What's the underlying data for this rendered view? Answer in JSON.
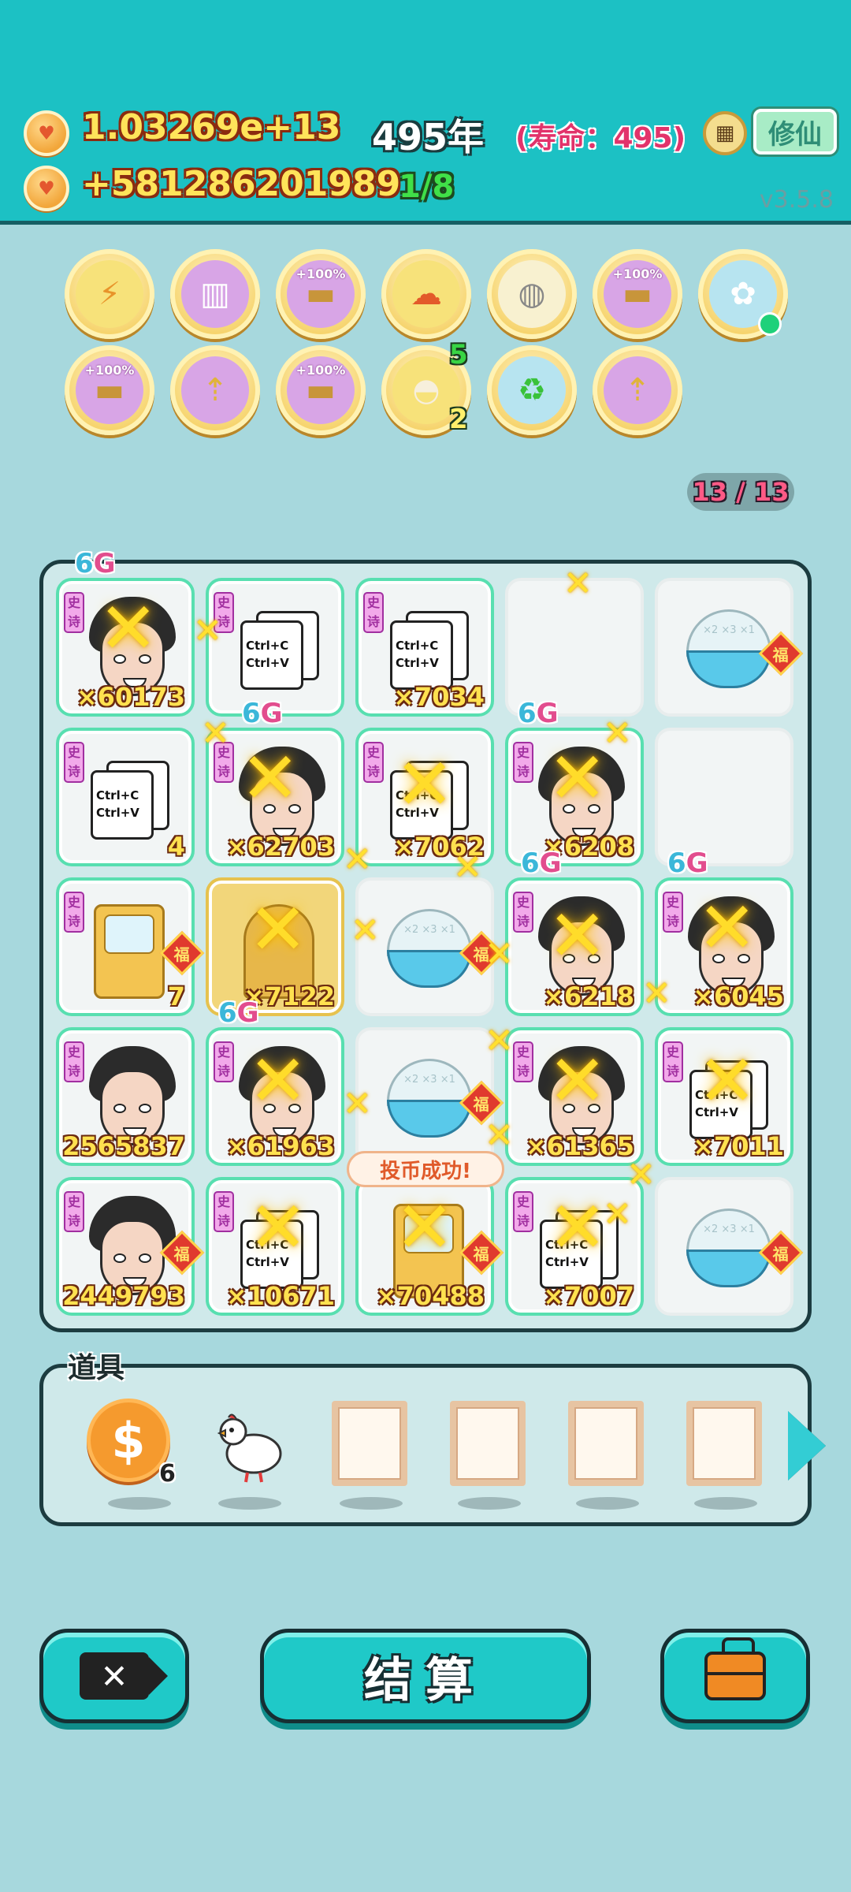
{
  "header": {
    "coins_total": "1.03269e+13",
    "coins_rate": "+581286201989",
    "year": "495年",
    "lifespan": "(寿命：495)",
    "ratio": "1/8",
    "cultivate_label": "修仙",
    "version": "v3.5.8"
  },
  "buffs": {
    "pct_label": "+100%",
    "shell_top_count": "5",
    "shell_bottom_count": "2"
  },
  "board": {
    "counter": "13 / 13",
    "tag_text": "史诗",
    "fu_text": "福",
    "six_g": {
      "six": "6",
      "g": "G"
    },
    "ctrl_c": "Ctrl+C",
    "ctrl_v": "Ctrl+V",
    "bowl_text": "×2 ×3 ×1",
    "cells": {
      "r1c1": "×60173",
      "r1c3": "×7034",
      "r2c1": "4",
      "r2c2": "×62703",
      "r2c3": "×7062",
      "r2c4": "×6208",
      "r3c1": "7",
      "r3c2": "×7122",
      "r3c4": "×6218",
      "r3c5": "×6045",
      "r4c1": "2565837",
      "r4c2": "×61963",
      "r4c4": "×61365",
      "r4c5": "×7011",
      "r5c1": "2449793",
      "r5c2": "×10671",
      "r5c3": "×70488",
      "r5c4": "×7007"
    },
    "toast": "投币成功!"
  },
  "items": {
    "label": "道具",
    "coin_count": "6"
  },
  "buttons": {
    "settle": "结算"
  },
  "colors": {
    "header_bg": "#1cc1c4",
    "page_bg": "#a7d8dd",
    "accent_button": "#1fc9c8",
    "cell_border": "#58dfb0"
  }
}
